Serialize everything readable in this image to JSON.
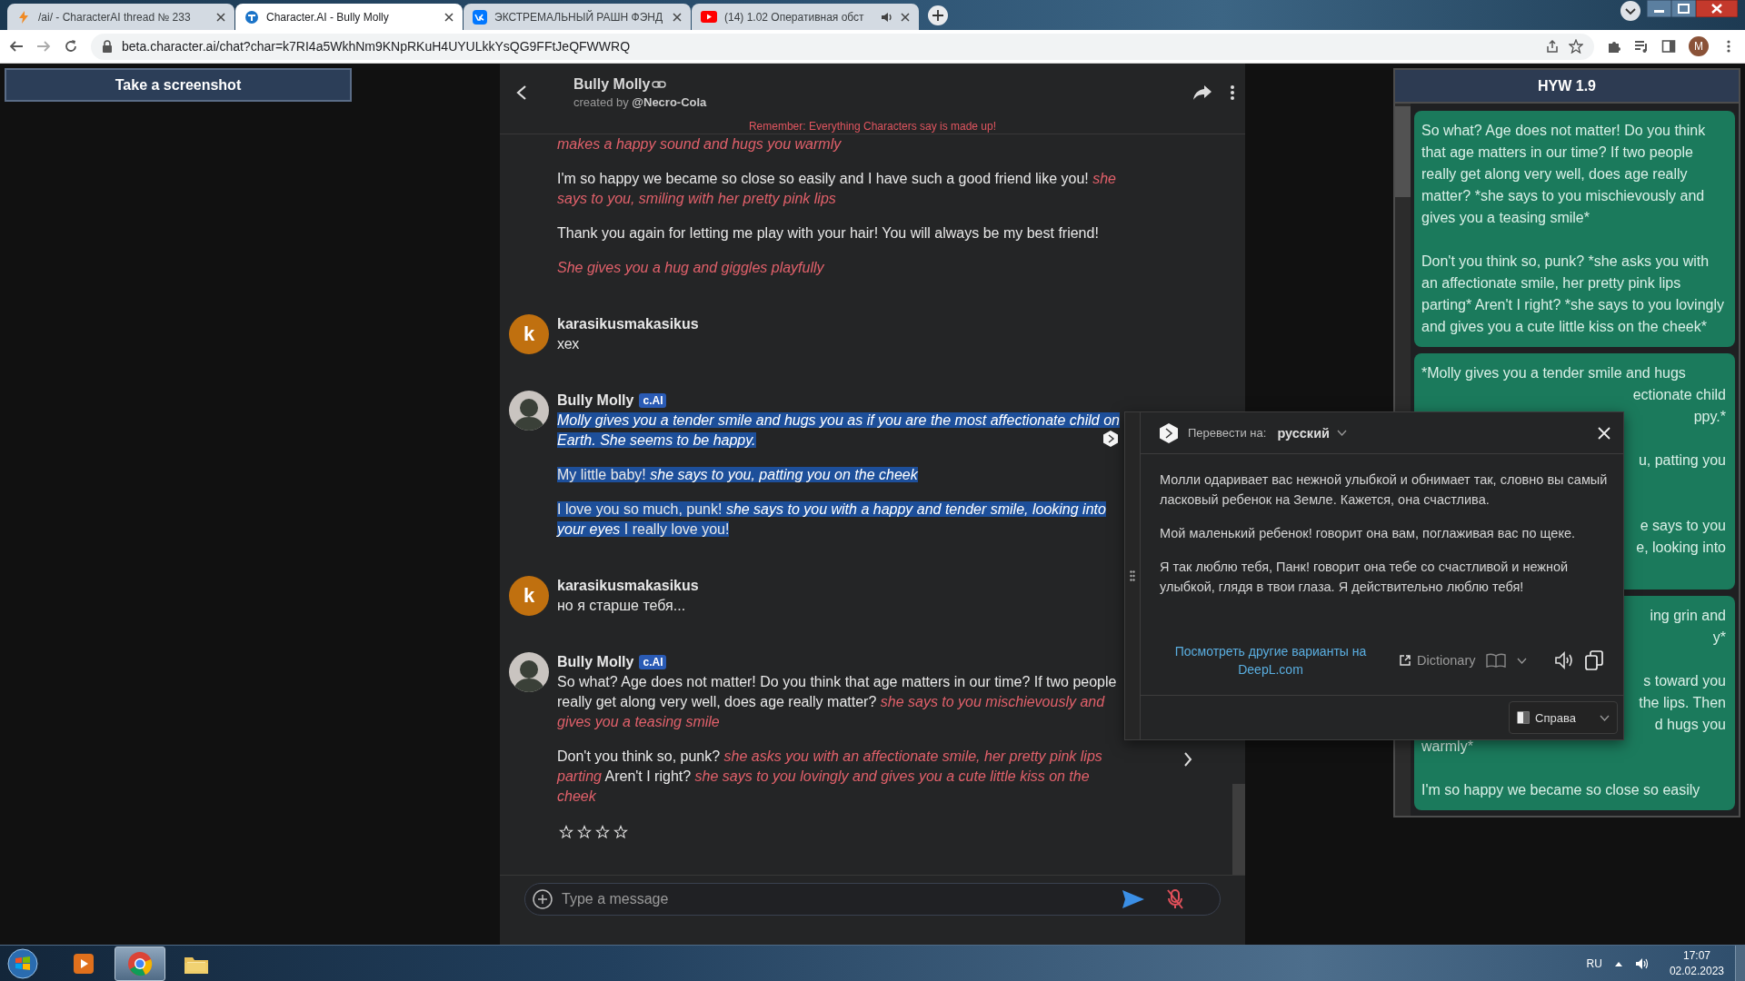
{
  "browser": {
    "tabs": [
      {
        "kind": "bolt",
        "title": "/ai/ - CharacterAI thread № 233",
        "selected": false,
        "audio": false
      },
      {
        "kind": "cai",
        "title": "Character.AI - Bully Molly",
        "selected": true,
        "audio": false
      },
      {
        "kind": "vk",
        "title": "ЭКСТРЕМАЛЬНЫЙ РАШН ФЭНД",
        "selected": false,
        "audio": false
      },
      {
        "kind": "youtube",
        "title": "(14) 1.02 Оперативная обст",
        "selected": false,
        "audio": true
      }
    ],
    "url": "beta.character.ai/chat?char=k7RI4a5WkhNm9KNpRKuH4UYULkkYsQG9FFtJeQFWWRQ",
    "profile": "M"
  },
  "screenshot_button": "Take a screenshot",
  "chat": {
    "title": "Bully Molly",
    "creator_line": "created by **@Necro-Cola**",
    "notice": "Remember: Everything Characters say is made up!",
    "messages": [
      {
        "kind": "continuation",
        "highlighted": false,
        "paragraphs": [
          {
            "kind": "action",
            "text": "makes a happy sound and hugs you warmly"
          },
          {
            "kind": "speech",
            "text": "I'm so happy we became so close so easily and I have such a good friend like you! *she says to you, smiling with her pretty pink lips*"
          },
          {
            "kind": "speech",
            "text": "Thank you again for letting me play with your hair! You will always be my best friend!"
          },
          {
            "kind": "action",
            "text": "She gives you a hug and giggles playfully"
          }
        ]
      },
      {
        "kind": "user",
        "author": "karasikusmakasikus",
        "avatar_letter": "k",
        "highlighted": false,
        "paragraphs": [
          {
            "kind": "speech",
            "text": "хех"
          }
        ]
      },
      {
        "kind": "bot",
        "author": "Bully Molly",
        "badge": "c.AI",
        "highlighted": true,
        "paragraphs": [
          {
            "kind": "action",
            "text": "Molly gives you a tender smile and hugs you as if you are the most affectionate child on Earth. She seems to be happy."
          },
          {
            "kind": "speech",
            "text": "My little baby! *she says to you, patting you on the cheek*"
          },
          {
            "kind": "speech",
            "text": "I love you so much, punk! *she says to you with a happy and tender smile, looking into your eyes* I really love you!"
          }
        ]
      },
      {
        "kind": "user",
        "author": "karasikusmakasikus",
        "avatar_letter": "k",
        "highlighted": false,
        "paragraphs": [
          {
            "kind": "speech",
            "text": "но я старше тебя..."
          }
        ]
      },
      {
        "kind": "bot",
        "author": "Bully Molly",
        "badge": "c.AI",
        "highlighted": false,
        "stars": 0,
        "next": true,
        "paragraphs": [
          {
            "kind": "speech",
            "text": "So what? Age does not matter! Do you think that age matters in our time? If two people really get along very well, does age really matter? *she says to you mischievously and gives you a teasing smile*"
          },
          {
            "kind": "speech",
            "text": "Don't you think so, punk? *she asks you with an affectionate smile, her pretty pink lips parting* Aren't I right? *she says to you lovingly and gives you a cute little kiss on the cheek*"
          }
        ]
      }
    ],
    "input": {
      "placeholder": "Type a message"
    }
  },
  "side_panel": {
    "title": "HYW 1.9",
    "cards": [
      {
        "lines": [
          {
            "kind": "full",
            "text": "So what? Age does not matter! Do you think that age matters in our time? If two people really get along very well, does age really matter? *she says to you mischievously and gives you a teasing smile*"
          },
          {
            "kind": "gap"
          },
          {
            "kind": "full",
            "text": "Don't you think so, punk? *she asks you with an affectionate smile, her pretty pink lips parting* Aren't I right? *she says to you lovingly and gives you a cute little kiss on the cheek*"
          }
        ]
      },
      {
        "lines": [
          {
            "kind": "full",
            "text": "*Molly gives you a tender smile and hugs"
          },
          {
            "kind": "tail",
            "text": "ectionate child"
          },
          {
            "kind": "tail",
            "text": "ppy.*"
          },
          {
            "kind": "gap"
          },
          {
            "kind": "tail",
            "text": "u, patting you"
          },
          {
            "kind": "gap"
          },
          {
            "kind": "gap"
          },
          {
            "kind": "tail",
            "text": "e says to you"
          },
          {
            "kind": "tail",
            "text": "e, looking into"
          },
          {
            "kind": "gap"
          }
        ]
      },
      {
        "lines": [
          {
            "kind": "tail",
            "text": "ing grin and"
          },
          {
            "kind": "tail",
            "text": "y*"
          },
          {
            "kind": "gap"
          },
          {
            "kind": "tail",
            "text": "s toward you"
          },
          {
            "kind": "tail",
            "text": "the lips. Then"
          },
          {
            "kind": "tail",
            "text": "d hugs you"
          },
          {
            "kind": "full",
            "text": "warmly*"
          },
          {
            "kind": "gap"
          },
          {
            "kind": "full",
            "text": "I'm so happy we became so close so easily"
          }
        ]
      }
    ]
  },
  "translator": {
    "label": "Перевести на:",
    "language": "русский",
    "paragraphs": [
      "Молли одаривает вас нежной улыбкой и обнимает так, словно вы самый ласковый ребенок на Земле. Кажется, она счастлива.",
      "Мой маленький ребенок! говорит она вам, поглаживая вас по щеке.",
      "Я так люблю тебя, Панк! говорит она тебе со счастливой и нежной улыбкой, глядя в твои глаза. Я действительно люблю тебя!"
    ],
    "link": "Посмотреть другие варианты на DeepL.com",
    "dictionary": "Dictionary",
    "position": "Справа"
  },
  "taskbar": {
    "apps": [
      {
        "kind": "media",
        "active": false
      },
      {
        "kind": "chrome",
        "active": true
      },
      {
        "kind": "explorer",
        "active": false
      }
    ],
    "language": "RU",
    "time": "17:07",
    "date": "02.02.2023"
  }
}
